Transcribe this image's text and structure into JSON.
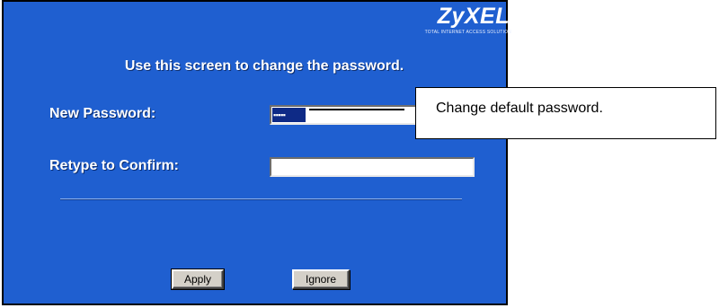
{
  "brand": {
    "logo_text": "ZyXEL",
    "tagline": "TOTAL INTERNET ACCESS SOLUTION"
  },
  "form": {
    "heading": "Use this screen to change the password.",
    "new_password": {
      "label": "New Password:",
      "masked_value": "▪▪▪▪▪"
    },
    "retype": {
      "label": "Retype to Confirm:",
      "value": ""
    }
  },
  "buttons": {
    "apply_label": "Apply",
    "ignore_label": "Ignore"
  },
  "callout": {
    "text": "Change default password."
  },
  "colors": {
    "panel_background": "#1f5fd0",
    "button_face": "#d4d0c8"
  }
}
